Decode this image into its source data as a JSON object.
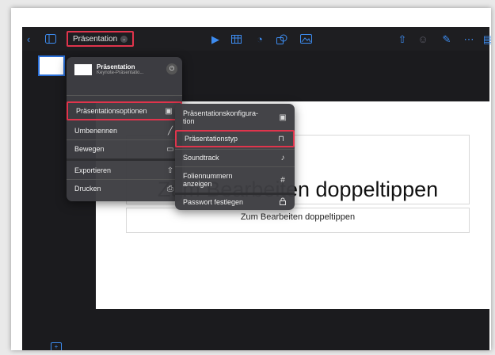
{
  "toolbar": {
    "presentation_label": "Präsentation",
    "icons": [
      "back-icon",
      "sidebar-icon",
      "play-icon",
      "table-icon",
      "chart-icon",
      "shape-icon",
      "media-icon",
      "share-icon",
      "collaborate-icon",
      "format-brush-icon",
      "more-icon",
      "document-icon"
    ]
  },
  "slide": {
    "title": "Zum Bearbeiten doppeltippen",
    "subtitle": "Zum Bearbeiten doppeltippen"
  },
  "menu_main": {
    "doc_name": "Präsentation",
    "doc_subtitle": "Keynote-Präsentatio...",
    "items": [
      {
        "label": "Präsentationsoptionen",
        "icon": "▣"
      },
      {
        "label": "Umbenennen",
        "icon": "╱"
      },
      {
        "label": "Bewegen",
        "icon": "▭"
      },
      {
        "label": "Exportieren",
        "icon": "⇧"
      },
      {
        "label": "Drucken",
        "icon": "⎙"
      }
    ]
  },
  "menu_sub": {
    "items": [
      {
        "label": "Präsentationskonfigura-\ntion",
        "icon": "▣"
      },
      {
        "label": "Präsentationstyp",
        "icon": "⊓"
      },
      {
        "label": "Soundtrack",
        "icon": "♪"
      },
      {
        "label": "Foliennummern\nanzeigen",
        "icon": "#"
      },
      {
        "label": "Passwort festlegen",
        "icon": "🔒"
      }
    ]
  },
  "colors": {
    "accent": "#3d8cf0",
    "highlight": "#e0344c",
    "menu_bg": "#3e3e42"
  }
}
